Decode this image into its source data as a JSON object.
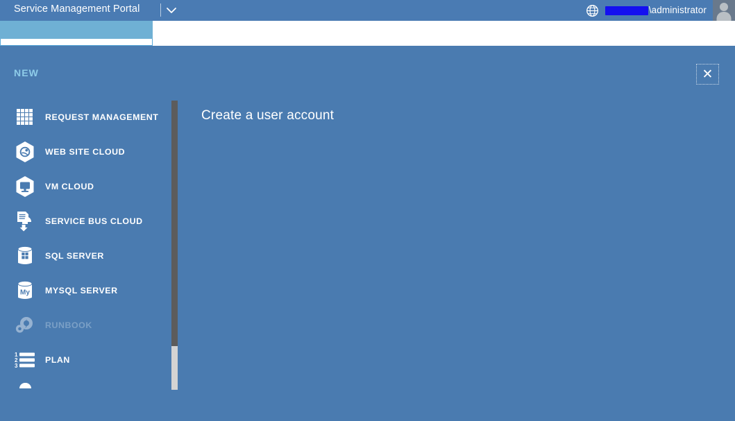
{
  "topbar": {
    "title": "Service Management Portal",
    "dropdown_icon": "chevron-down-icon",
    "globe_icon": "globe-icon",
    "account_redacted": "",
    "account_name": "\\administrator",
    "avatar_icon": "user-avatar-icon",
    "bg_color": "#4a7bb3"
  },
  "tabstrip": {
    "active_tab_color": "#6fb0d4",
    "border_color": "#59a8d8"
  },
  "overlay": {
    "heading": "NEW",
    "heading_color": "#8ecce9",
    "bg_color": "#4a7bb0",
    "close_label": "✕"
  },
  "sidebar": {
    "items": [
      {
        "label": "REQUEST MANAGEMENT",
        "icon": "grid-icon",
        "disabled": false
      },
      {
        "label": "WEB SITE CLOUD",
        "icon": "web-site-cloud-icon",
        "disabled": false
      },
      {
        "label": "VM CLOUD",
        "icon": "vm-cloud-icon",
        "disabled": false
      },
      {
        "label": "SERVICE BUS CLOUD",
        "icon": "service-bus-cloud-icon",
        "disabled": false
      },
      {
        "label": "SQL SERVER",
        "icon": "sql-server-icon",
        "disabled": false
      },
      {
        "label": "MYSQL SERVER",
        "icon": "mysql-server-icon",
        "disabled": false
      },
      {
        "label": "RUNBOOK",
        "icon": "runbook-gear-icon",
        "disabled": true
      },
      {
        "label": "PLAN",
        "icon": "numbered-list-icon",
        "disabled": false
      }
    ],
    "scrollbar": {
      "track_color": "#5c5c5c",
      "thumb_color": "#d3d3d3"
    }
  },
  "content": {
    "title": "Create a user account"
  }
}
